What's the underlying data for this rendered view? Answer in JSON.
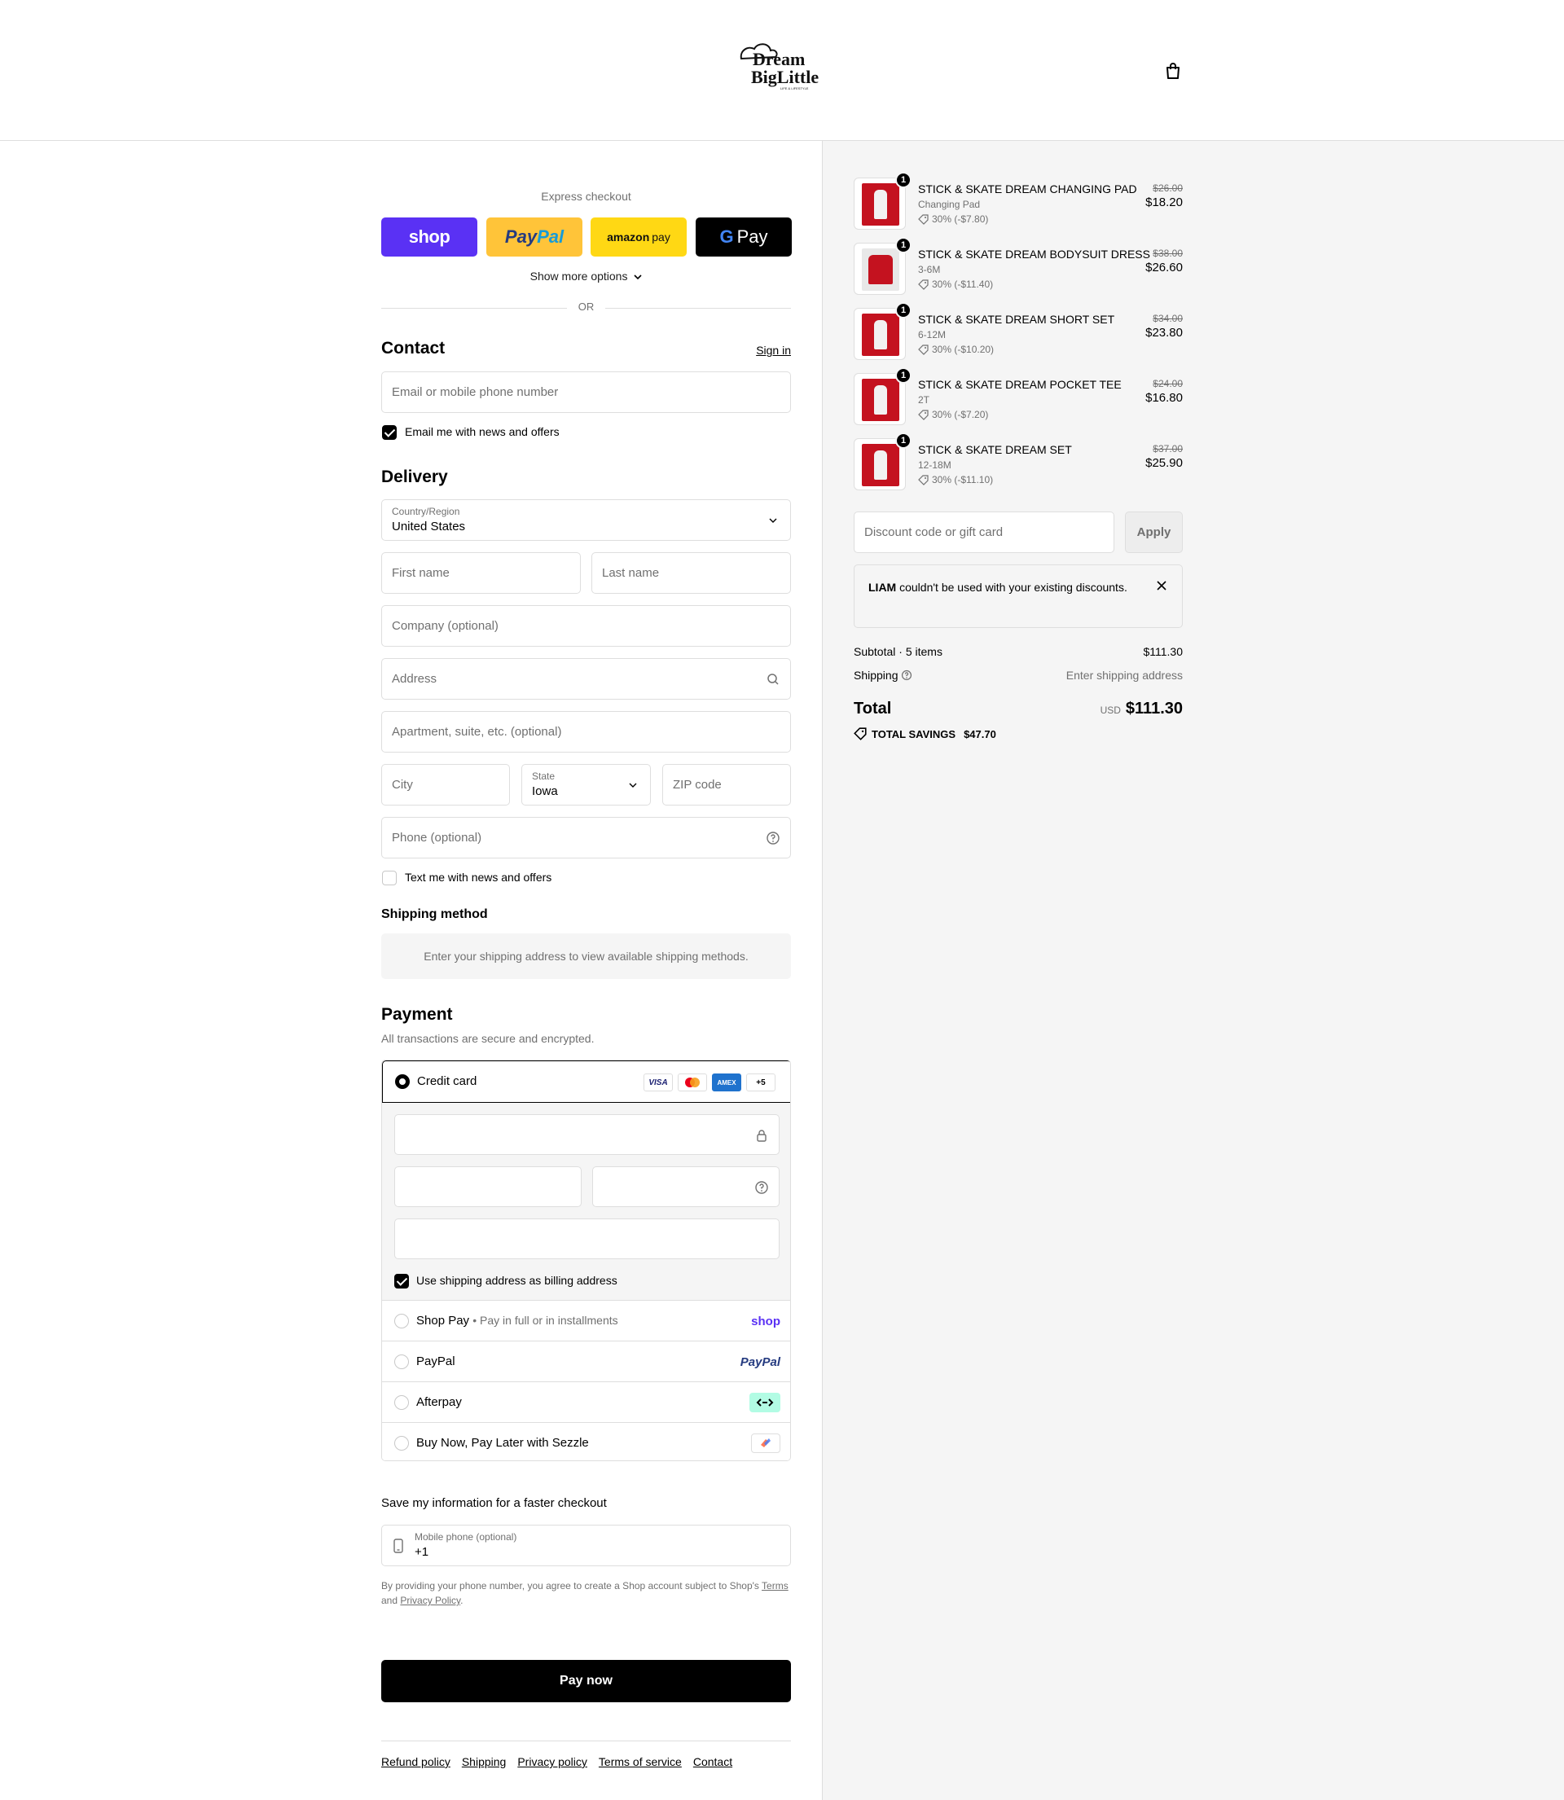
{
  "brand": {
    "logo_line1": "Dream",
    "logo_line2": "BigLittle",
    "logo_tagline": "LIFE & LIFESTYLE"
  },
  "express": {
    "label": "Express checkout",
    "shop": "shop",
    "paypal_a": "Pay",
    "paypal_b": "Pal",
    "amazon_a": "amazon",
    "amazon_b": "pay",
    "gpay_g": "G",
    "gpay_label": "Pay",
    "more_options": "Show more options",
    "or": "OR"
  },
  "contact": {
    "title": "Contact",
    "signin": "Sign in",
    "email_placeholder": "Email or mobile phone number",
    "news_label": "Email me with news and offers",
    "news_checked": true
  },
  "delivery": {
    "title": "Delivery",
    "country_label": "Country/Region",
    "country_value": "United States",
    "first_name": "First name",
    "last_name": "Last name",
    "company": "Company (optional)",
    "address": "Address",
    "apartment": "Apartment, suite, etc. (optional)",
    "city": "City",
    "state_label": "State",
    "state_value": "Iowa",
    "zip": "ZIP code",
    "phone": "Phone (optional)",
    "text_label": "Text me with news and offers",
    "text_checked": false
  },
  "shipping_method": {
    "title": "Shipping method",
    "message": "Enter your shipping address to view available shipping methods."
  },
  "payment": {
    "title": "Payment",
    "subtitle": "All transactions are secure and encrypted.",
    "credit_card": "Credit card",
    "card_more": "+5",
    "card_visa": "VISA",
    "card_amex": "AMEX",
    "billing_label": "Use shipping address as billing address",
    "billing_checked": true,
    "options": [
      {
        "label": "Shop Pay",
        "sub": "Pay in full or in installments",
        "logo": "shop"
      },
      {
        "label": "PayPal",
        "sub": "",
        "logo": "PayPal"
      },
      {
        "label": "Afterpay",
        "sub": "",
        "logo": "afterpay"
      },
      {
        "label": "Buy Now, Pay Later with Sezzle",
        "sub": "",
        "logo": "sezzle"
      }
    ]
  },
  "save_info": {
    "title": "Save my information for a faster checkout",
    "phone_label": "Mobile phone (optional)",
    "phone_value": "+1",
    "legal_a": "By providing your phone number, you agree to create a Shop account subject to Shop's",
    "legal_terms": "Terms",
    "legal_and": "and",
    "legal_privacy": "Privacy Policy",
    "legal_end": "."
  },
  "pay_now": "Pay now",
  "footer": [
    "Refund policy",
    "Shipping",
    "Privacy policy",
    "Terms of service",
    "Contact"
  ],
  "cart": {
    "items": [
      {
        "qty": "1",
        "name": "STICK & SKATE DREAM CHANGING PAD",
        "variant": "Changing Pad",
        "discount": "30% (-$7.80)",
        "old_price": "$26.00",
        "price": "$18.20"
      },
      {
        "qty": "1",
        "name": "STICK & SKATE DREAM BODYSUIT DRESS",
        "variant": "3-6M",
        "discount": "30% (-$11.40)",
        "old_price": "$38.00",
        "price": "$26.60"
      },
      {
        "qty": "1",
        "name": "STICK & SKATE DREAM SHORT SET",
        "variant": "6-12M",
        "discount": "30% (-$10.20)",
        "old_price": "$34.00",
        "price": "$23.80"
      },
      {
        "qty": "1",
        "name": "STICK & SKATE DREAM POCKET TEE",
        "variant": "2T",
        "discount": "30% (-$7.20)",
        "old_price": "$24.00",
        "price": "$16.80"
      },
      {
        "qty": "1",
        "name": "STICK & SKATE DREAM SET",
        "variant": "12-18M",
        "discount": "30% (-$11.10)",
        "old_price": "$37.00",
        "price": "$25.90"
      }
    ],
    "discount_placeholder": "Discount code or gift card",
    "apply": "Apply",
    "notice_code": "LIAM",
    "notice_text": "couldn't be used with your existing discounts.",
    "subtotal_label": "Subtotal · 5 items",
    "subtotal_value": "$111.30",
    "shipping_label": "Shipping",
    "shipping_value": "Enter shipping address",
    "total_label": "Total",
    "total_currency": "USD",
    "total_value": "$111.30",
    "savings_label": "TOTAL SAVINGS",
    "savings_value": "$47.70"
  }
}
